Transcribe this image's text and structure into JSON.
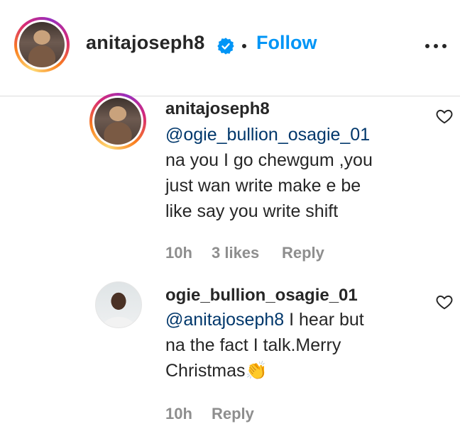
{
  "header": {
    "username": "anitajoseph8",
    "follow_label": "Follow",
    "more_icon": "more-horizontal-icon",
    "verified_icon": "verified-badge-icon",
    "separator": "•"
  },
  "comments": [
    {
      "username": "anitajoseph8",
      "mention": "@ogie_bullion_osagie_01",
      "text_lines": [
        "na you I go chewgum ,you",
        "just wan write make e be",
        "like say you write shift"
      ],
      "time": "10h",
      "likes": "3 likes",
      "reply_label": "Reply"
    },
    {
      "username": "ogie_bullion_osagie_01",
      "mention": "@anitajoseph8",
      "text_first": " I hear but",
      "text_lines": [
        "na the fact I talk.Merry",
        "Christmas👏"
      ],
      "time": "10h",
      "reply_label": "Reply"
    }
  ],
  "colors": {
    "accent_blue": "#0095f6",
    "mention_blue": "#00376b",
    "meta_gray": "#8e8e8e",
    "text": "#262626"
  }
}
